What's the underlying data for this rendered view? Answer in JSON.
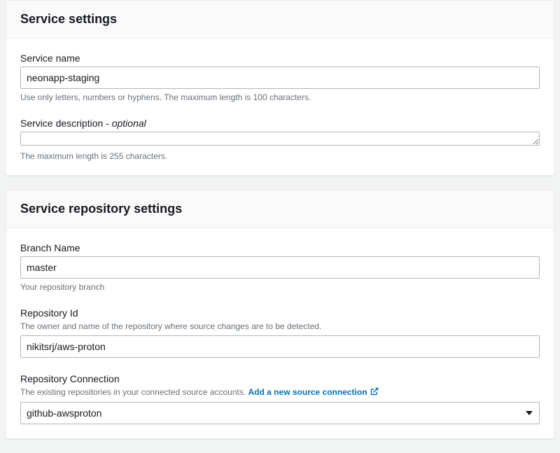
{
  "serviceSettings": {
    "title": "Service settings",
    "serviceName": {
      "label": "Service name",
      "value": "neonapp-staging",
      "hint": "Use only letters, numbers or hyphens. The maximum length is 100 characters."
    },
    "serviceDescription": {
      "label": "Service description - ",
      "optional": "optional",
      "value": "",
      "hint": "The maximum length is 255 characters."
    }
  },
  "repoSettings": {
    "title": "Service repository settings",
    "branchName": {
      "label": "Branch Name",
      "value": "master",
      "hint": "Your repository branch"
    },
    "repositoryId": {
      "label": "Repository Id",
      "hintTop": "The owner and name of the repository where source changes are to be detected.",
      "value": "nikitsrj/aws-proton"
    },
    "repositoryConnection": {
      "label": "Repository Connection",
      "hintTop": "The existing repositories in your connected source accounts. ",
      "linkText": "Add a new source connection",
      "value": "github-awsproton"
    }
  }
}
